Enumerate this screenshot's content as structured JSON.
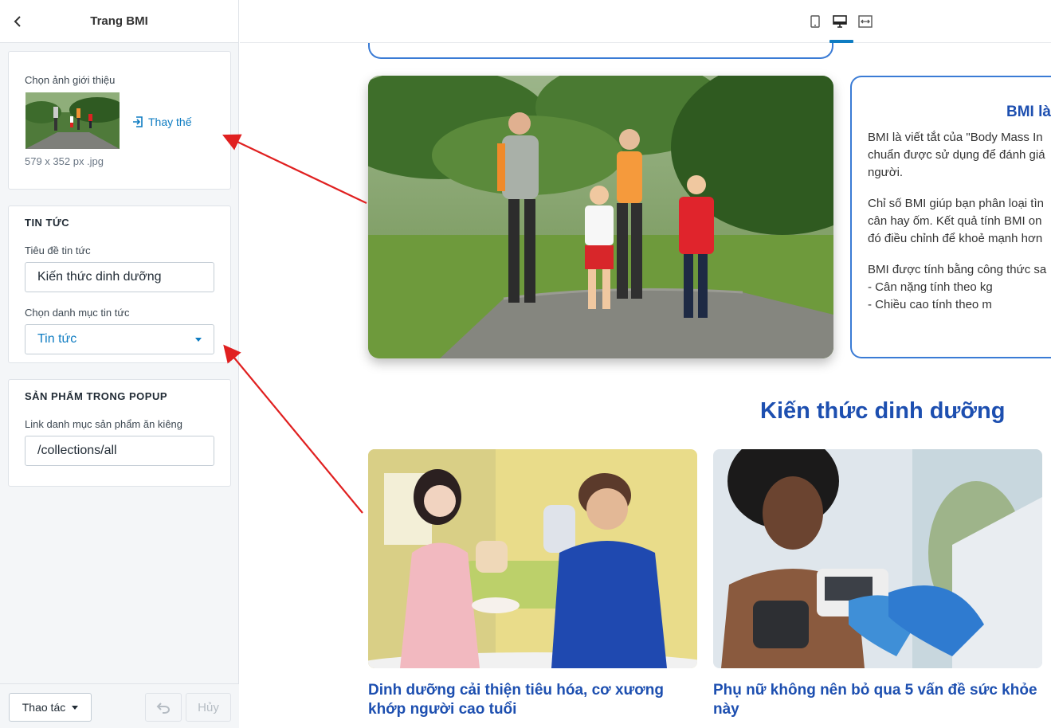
{
  "sidebar": {
    "title": "Trang BMI",
    "intro_image": {
      "label": "Chọn ảnh giới thiệu",
      "replace_label": "Thay thế",
      "meta": "579 x 352 px .jpg"
    },
    "news": {
      "section_title": "TIN TỨC",
      "title_label": "Tiêu đề tin tức",
      "title_value": "Kiến thức dinh dưỡng",
      "category_label": "Chọn danh mục tin tức",
      "category_value": "Tin tức"
    },
    "popup": {
      "section_title": "SẢN PHẨM TRONG POPUP",
      "link_label": "Link danh mục sản phẩm ăn kiêng",
      "link_value": "/collections/all"
    },
    "footer": {
      "actions_label": "Thao tác",
      "cancel_label": "Hủy"
    }
  },
  "preview": {
    "device_icons": [
      "mobile-icon",
      "desktop-icon",
      "fullscreen-icon"
    ],
    "active_device": "desktop",
    "info": {
      "title": "BMI là",
      "para1": [
        "BMI là viết tắt của \"Body Mass In",
        "chuẩn được sử dụng để đánh giá",
        "người."
      ],
      "para2": [
        "Chỉ số BMI giúp bạn phân loại tìn",
        "cân hay ốm. Kết quả tính BMI on",
        "đó điều chỉnh để khoẻ mạnh hơn"
      ],
      "para3": [
        "BMI được tính bằng công thức sa",
        "- Cân nặng tính theo kg",
        "- Chiều cao tính theo m"
      ]
    },
    "news_heading": "Kiến thức dinh dưỡng",
    "articles": [
      {
        "title": "Dinh dưỡng cải thiện tiêu hóa, cơ xương khớp người cao tuổi"
      },
      {
        "title": "Phụ nữ không nên bỏ qua 5 vấn đề sức khỏe này"
      }
    ]
  },
  "colors": {
    "accent": "#0e7cc2",
    "heading_blue": "#1d4fb0",
    "box_border": "#3a7bd5",
    "arrow": "#e02020"
  }
}
